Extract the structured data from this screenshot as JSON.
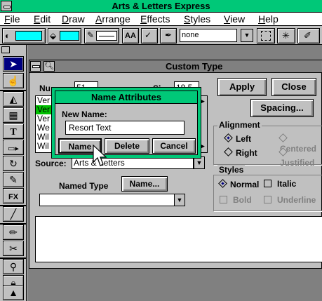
{
  "app": {
    "title": "Arts & Letters Express"
  },
  "menu": [
    "File",
    "Edit",
    "Draw",
    "Arrange",
    "Effects",
    "Styles",
    "View",
    "Help"
  ],
  "toolbar": {
    "text_style": "AA",
    "fill_value": "none",
    "colors": {
      "fill_swatch": "#00ffff",
      "line_swatch": "#00ffff"
    }
  },
  "custom_type": {
    "title": "Custom Type",
    "number_label": "Nu",
    "number_value": "51",
    "size_label": "Si",
    "size_value": "18.5",
    "list": [
      "Ver",
      "Ver",
      "Ver",
      "We",
      "Wil",
      "Wil"
    ],
    "selected_index": 1,
    "source_label": "Source:",
    "source_value": "Arts & Letters",
    "named_type_label": "Named Type",
    "name_button": "Name...",
    "apply_button": "Apply",
    "close_button": "Close",
    "spacing_button": "Spacing...",
    "alignment": {
      "label": "Alignment",
      "options": [
        "Left",
        "Centered",
        "Right",
        "Justified"
      ],
      "selected": "Left"
    },
    "styles": {
      "label": "Styles",
      "normal": "Normal",
      "italic": "Italic",
      "bold": "Bold",
      "underline": "Underline"
    }
  },
  "name_attributes": {
    "title": "Name Attributes",
    "new_name_label": "New Name:",
    "new_name_value": "Resort Text",
    "name_button": "Name",
    "delete_button": "Delete",
    "cancel_button": "Cancel"
  },
  "colors": {
    "title_green": "#00c878",
    "selection_green": "#00c000",
    "accent_navy": "#000080"
  }
}
